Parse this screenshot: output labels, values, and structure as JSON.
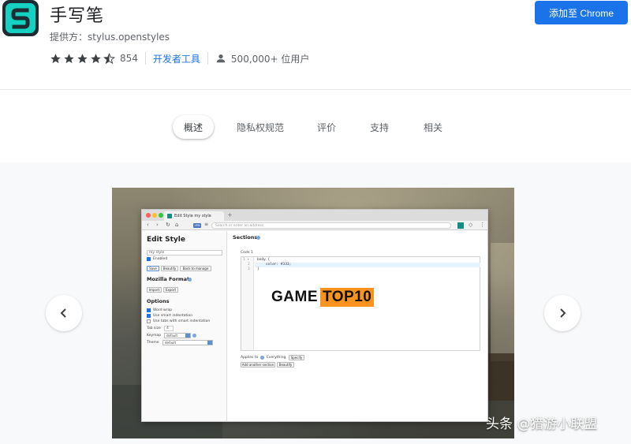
{
  "extension": {
    "name": "手写笔",
    "provider": "提供方：stylus.openstyles",
    "rating_count": "854",
    "rating_value": 4.5,
    "category": "开发者工具",
    "users": "500,000+ 位用户",
    "logo_letter": "S"
  },
  "actions": {
    "add_button": "添加至 Chrome"
  },
  "tabs": [
    {
      "label": "概述",
      "active": true
    },
    {
      "label": "隐私权规范",
      "active": false
    },
    {
      "label": "评价",
      "active": false
    },
    {
      "label": "支持",
      "active": false
    },
    {
      "label": "相关",
      "active": false
    }
  ],
  "screenshot": {
    "browser_tab_title": "Edit Style my style",
    "address_placeholder": "Search or enter an address",
    "vpn_label": "VPN",
    "editor": {
      "title": "Edit Style",
      "style_name": "my style",
      "enabled_label": "Enabled",
      "save_button": "Save",
      "beautify_button": "Beautify",
      "back_button": "Back to manage",
      "mozilla_format": "Mozilla Format",
      "import_button": "Import",
      "export_button": "Export",
      "options_title": "Options",
      "options": [
        {
          "label": "Word wrap",
          "checked": true
        },
        {
          "label": "Use smart indentation",
          "checked": true
        },
        {
          "label": "Use tabs with smart indentation",
          "checked": false
        }
      ],
      "tab_size_label": "Tab size",
      "tab_size_value": "4",
      "keymap_label": "Keymap",
      "keymap_value": "default",
      "theme_label": "Theme",
      "theme_value": "default",
      "sections_title": "Sections",
      "code_label": "Code 1",
      "code_lines": [
        "body {",
        "    color: #333;",
        "}"
      ],
      "line_numbers": [
        "1 ▾",
        "2",
        "3"
      ],
      "applies_to_label": "Applies to",
      "applies_to_value": "Everything",
      "specify_button": "Specify",
      "add_section_button": "Add another section",
      "beautify_button_2": "Beautify"
    },
    "watermark": {
      "part_a": "GAME",
      "part_b": "TOP10"
    },
    "credit": "头条 @猎游小联盟"
  },
  "colors": {
    "accent": "#1a73e8",
    "logo_teal": "#14d1c2",
    "watermark_orange": "#f7931e"
  }
}
